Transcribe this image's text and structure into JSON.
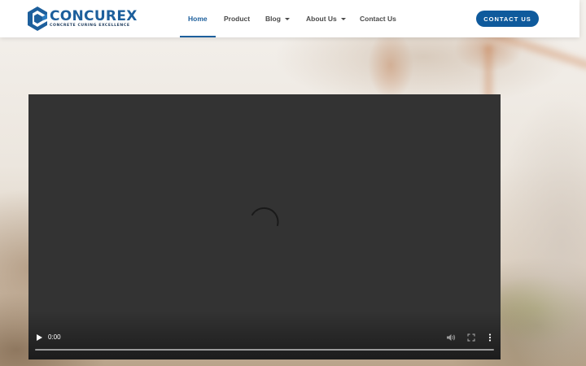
{
  "brand": {
    "name": "CONCUREX",
    "tagline": "CONCRETE CURING EXCELLENCE",
    "color": "#1d5f9c"
  },
  "nav": {
    "items": [
      {
        "label": "Home",
        "active": true
      },
      {
        "label": "Product"
      },
      {
        "label": "Blog",
        "has_dropdown": true
      },
      {
        "label": "About Us",
        "has_dropdown": true
      },
      {
        "label": "Contact Us"
      }
    ]
  },
  "cta": {
    "label": "CONTACT US",
    "color": "#0f5a9c"
  },
  "video": {
    "time": "0:00",
    "state": "loading",
    "icons": [
      "play-icon",
      "volume-icon",
      "fullscreen-icon",
      "more-options-icon",
      "loading-spinner-icon"
    ]
  }
}
